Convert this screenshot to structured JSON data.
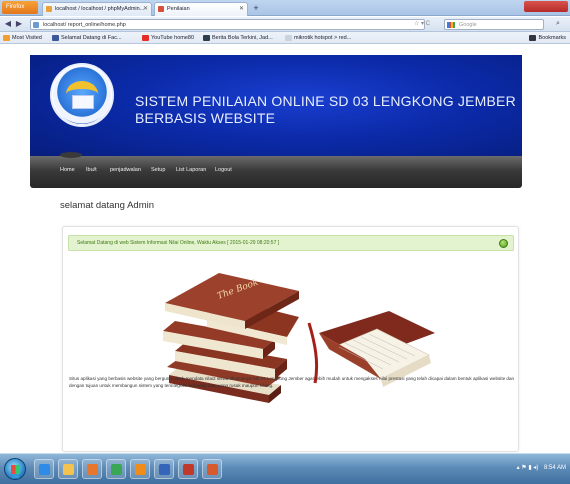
{
  "browser": {
    "app_button": "Firefox",
    "tabs": [
      {
        "label": "localhost / localhost / phpMyAdmin..."
      },
      {
        "label": "Penilaian"
      }
    ],
    "new_tab": "+",
    "url": "localhost/ report_online/home.php",
    "url_right": "☆ ▾ C",
    "search_placeholder": "Google",
    "bookmarks": [
      {
        "label": "Most Visited",
        "color": "#f0a030"
      },
      {
        "label": "Selamat Datang di Fac...",
        "color": "#3b5998"
      },
      {
        "label": "YouTube home80",
        "color": "#e52d27"
      },
      {
        "label": "Berita Bola Terkini, Jad...",
        "color": "#2d3e50"
      },
      {
        "label": "mikrotik hotspot > red...",
        "color": "#c9d3df"
      }
    ],
    "bookmarks_right": "Bookmarks"
  },
  "header": {
    "title_line1": "SISTEM PENILAIAN ONLINE SD 03 LENGKONG JEMBER",
    "title_line2": "BERBASIS WEBSITE"
  },
  "menu": [
    {
      "label": "Home"
    },
    {
      "label": "Ibu/t"
    },
    {
      "label": "penjadwalan"
    },
    {
      "label": "Setup"
    },
    {
      "label": "List Laporan"
    },
    {
      "label": "Logout"
    }
  ],
  "welcome": "selamat datang Admin",
  "alert": {
    "text": "Selamat Datang di web Sistem Informasi Nilai Online, Waktu Akses [ 2015-01-29 08:20:57 ]"
  },
  "description": "Situs aplikasi yang berbasis website yang berguna untuk mendata nilai2 siswa khususnya SD 03 Lengkong Jember agar lebih mudah untuk mengakses nilai prestasi yang telah dicapai dalam bentuk aplikasi website dan dengan tujuan untuk membangun sistem yang terintegrasi terhadap data yang rusak maupun hilang.",
  "book_cover_text": "The Book",
  "taskbar": {
    "tray_time": "8:54 AM"
  },
  "colors": {
    "header_blue": "#0b2aa8",
    "menu_dark": "#2b2b2b",
    "alert_green": "#e3f2cf"
  }
}
